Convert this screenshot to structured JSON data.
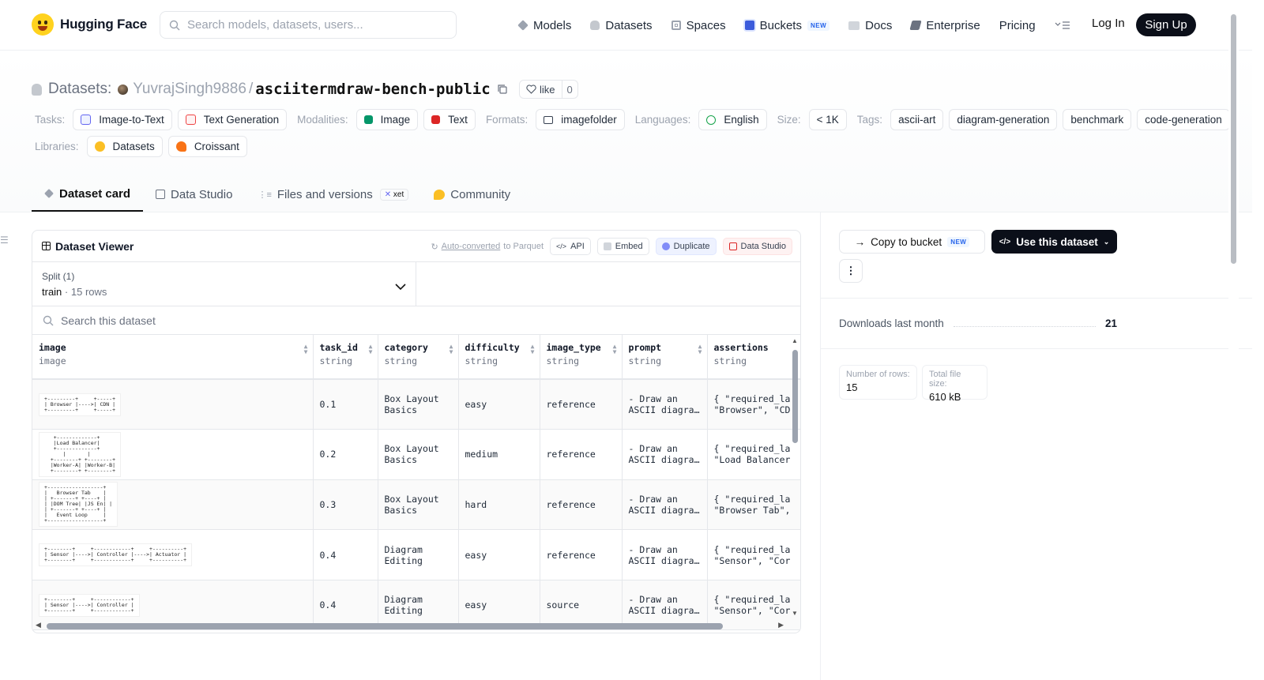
{
  "nav": {
    "brand": "Hugging Face",
    "search_placeholder": "Search models, datasets, users...",
    "links": [
      {
        "label": "Models",
        "icon": "models-icon",
        "color": "#9ca3af"
      },
      {
        "label": "Datasets",
        "icon": "datasets-icon",
        "color": "#9ca3af"
      },
      {
        "label": "Spaces",
        "icon": "spaces-icon",
        "color": "#9ca3af"
      },
      {
        "label": "Buckets",
        "icon": "buckets-icon",
        "color": "#3b5bdb",
        "badge": "NEW"
      },
      {
        "label": "Docs",
        "icon": "docs-icon",
        "color": "#9ca3af"
      },
      {
        "label": "Enterprise",
        "icon": "enterprise-icon",
        "color": "#6b7280"
      },
      {
        "label": "Pricing"
      }
    ],
    "login": "Log In",
    "signup": "Sign Up"
  },
  "header": {
    "section_label": "Datasets:",
    "owner": "YuvrajSingh9886",
    "repo": "asciitermdraw-bench-public",
    "like_label": "like",
    "like_count": "0",
    "tasks_label": "Tasks:",
    "tasks": [
      "Image-to-Text",
      "Text Generation"
    ],
    "modalities_label": "Modalities:",
    "modalities": [
      "Image",
      "Text"
    ],
    "formats_label": "Formats:",
    "formats": [
      "imagefolder"
    ],
    "languages_label": "Languages:",
    "languages": [
      "English"
    ],
    "size_label": "Size:",
    "size": "< 1K",
    "tags_label": "Tags:",
    "tags": [
      "ascii-art",
      "diagram-generation",
      "benchmark",
      "code-generation"
    ],
    "libraries_label": "Libraries:",
    "libraries": [
      "Datasets",
      "Croissant"
    ]
  },
  "tabs": [
    {
      "label": "Dataset card",
      "active": true
    },
    {
      "label": "Data Studio"
    },
    {
      "label": "Files and versions",
      "badge": "xet"
    },
    {
      "label": "Community"
    }
  ],
  "viewer": {
    "title": "Dataset Viewer",
    "auto_converted": "Auto-converted",
    "to_parquet": "to Parquet",
    "buttons": [
      "API",
      "Embed",
      "Duplicate",
      "Data Studio"
    ],
    "split_label": "Split (1)",
    "split_name": "train",
    "split_rows": "15 rows",
    "search_placeholder": "Search this dataset",
    "columns": [
      {
        "name": "image",
        "type": "image"
      },
      {
        "name": "task_id",
        "type": "string"
      },
      {
        "name": "category",
        "type": "string"
      },
      {
        "name": "difficulty",
        "type": "string"
      },
      {
        "name": "image_type",
        "type": "string"
      },
      {
        "name": "prompt",
        "type": "string"
      },
      {
        "name": "assertions",
        "type": "string"
      }
    ],
    "rows": [
      {
        "thumb": "+---------+     +-----+\n| Browser |---->| CDN |\n+---------+     +-----+",
        "task_id": "0.1",
        "category": "Box Layout\nBasics",
        "difficulty": "easy",
        "image_type": "reference",
        "prompt": "- Draw an\nASCII diagra…",
        "assertions": "{ \"required_la\n\"Browser\", \"CD"
      },
      {
        "thumb": "   +-------------+\n   |Load Balancer|\n   +-------------+\n      |       |\n  +--------+ +--------+\n  |Worker-A| |Worker-B|\n  +--------+ +--------+",
        "task_id": "0.2",
        "category": "Box Layout\nBasics",
        "difficulty": "medium",
        "image_type": "reference",
        "prompt": "- Draw an\nASCII diagra…",
        "assertions": "{ \"required_la\n\"Load Balancer"
      },
      {
        "thumb": "+------------------+\n|   Browser Tab    |\n| +-------+ +----+ |\n| |DOM Tree| |JS En| |\n| +-------+ +----+ |\n|   Event Loop     |\n+------------------+",
        "task_id": "0.3",
        "category": "Box Layout\nBasics",
        "difficulty": "hard",
        "image_type": "reference",
        "prompt": "- Draw an\nASCII diagra…",
        "assertions": "{ \"required_la\n\"Browser Tab\","
      },
      {
        "thumb": "+--------+     +------------+     +----------+\n| Sensor |---->| Controller |---->| Actuator |\n+--------+     +------------+     +----------+",
        "task_id": "0.4",
        "category": "Diagram\nEditing",
        "difficulty": "easy",
        "image_type": "reference",
        "prompt": "- Draw an\nASCII diagra…",
        "assertions": "{ \"required_la\n\"Sensor\", \"Cor"
      },
      {
        "thumb": "+--------+     +------------+\n| Sensor |---->| Controller |\n+--------+     +------------+",
        "task_id": "0.4",
        "category": "Diagram\nEditing",
        "difficulty": "easy",
        "image_type": "source",
        "prompt": "- Draw an\nASCII diagra…",
        "assertions": "{ \"required_la\n\"Sensor\", \"Cor"
      }
    ]
  },
  "sidebar": {
    "copy_label": "Copy to bucket",
    "copy_badge": "NEW",
    "use_label": "Use this dataset",
    "downloads_label": "Downloads last month",
    "downloads_value": "21",
    "rows_label": "Number of rows:",
    "rows_value": "15",
    "size_label": "Total file size:",
    "size_value": "610 kB"
  }
}
